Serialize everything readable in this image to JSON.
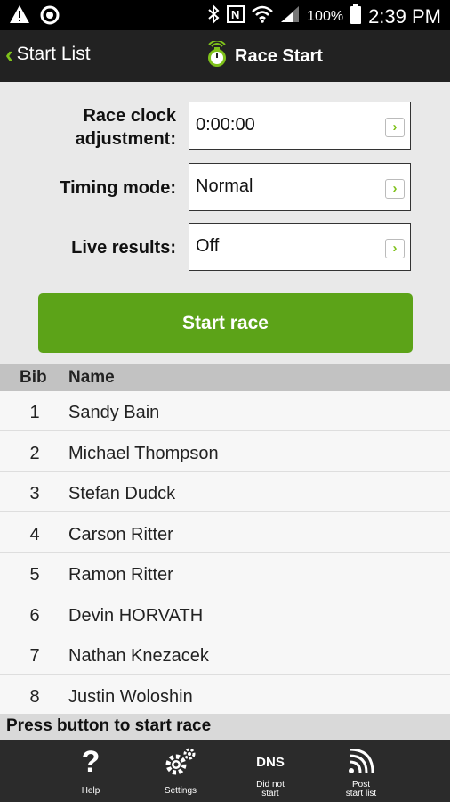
{
  "status_bar": {
    "battery_percent": "100%",
    "time": "2:39 PM"
  },
  "action_bar": {
    "back_label": "Start List",
    "title": "Race Start"
  },
  "form": {
    "race_clock_label_line1": "Race clock",
    "race_clock_label_line2": "adjustment:",
    "race_clock_value": "0:00:00",
    "timing_mode_label": "Timing mode:",
    "timing_mode_value": "Normal",
    "live_results_label": "Live results:",
    "live_results_value": "Off"
  },
  "start_button": "Start race",
  "table": {
    "headers": {
      "bib": "Bib",
      "name": "Name"
    },
    "rows": [
      {
        "bib": "1",
        "name": "Sandy Bain"
      },
      {
        "bib": "2",
        "name": "Michael Thompson"
      },
      {
        "bib": "3",
        "name": "Stefan Dudck"
      },
      {
        "bib": "4",
        "name": "Carson Ritter"
      },
      {
        "bib": "5",
        "name": "Ramon Ritter"
      },
      {
        "bib": "6",
        "name": "Devin HORVATH"
      },
      {
        "bib": "7",
        "name": "Nathan Knezacek"
      },
      {
        "bib": "8",
        "name": "Justin Woloshin"
      }
    ]
  },
  "status_message": "Press button to start race",
  "toolbar": {
    "help_label": "Help",
    "settings_label": "Settings",
    "dns_icon_text": "DNS",
    "dns_label_line1": "Did not",
    "dns_label_line2": "start",
    "post_label_line1": "Post",
    "post_label_line2": "start list"
  },
  "colors": {
    "accent": "#7fc21b",
    "button": "#5ca318",
    "header_bg": "#222222"
  }
}
